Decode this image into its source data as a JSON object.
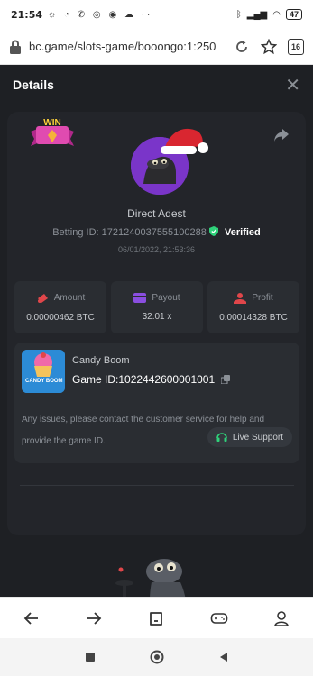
{
  "status_bar": {
    "time": "21:54",
    "battery": "47"
  },
  "browser": {
    "url": "bc.game/slots-game/booongo:1:250",
    "tab_count": "16"
  },
  "details": {
    "title": "Details",
    "badge_text": "WIN",
    "user_name": "Direct Adest",
    "betting_id_label": "Betting ID:",
    "betting_id": "1721240037555100288",
    "verified": "Verified",
    "datetime": "06/01/2022, 21:53:36",
    "stats": [
      {
        "label": "Amount",
        "value": "0.00000462 BTC",
        "icon": "amount-icon"
      },
      {
        "label": "Payout",
        "value": "32.01 x",
        "icon": "payout-icon"
      },
      {
        "label": "Profit",
        "value": "0.00014328 BTC",
        "icon": "profit-icon"
      }
    ],
    "game": {
      "name": "Candy Boom",
      "thumb_text": "CANDY BOOM",
      "id_label": "Game ID:",
      "id": "1022442600001001",
      "issues_text": "Any issues, please contact the customer service for help and provide the game ID.",
      "support_label": "Live Support"
    }
  },
  "colors": {
    "accent_green": "#2fd27a",
    "brand_purple": "#7a35c9",
    "red": "#e0464a"
  }
}
